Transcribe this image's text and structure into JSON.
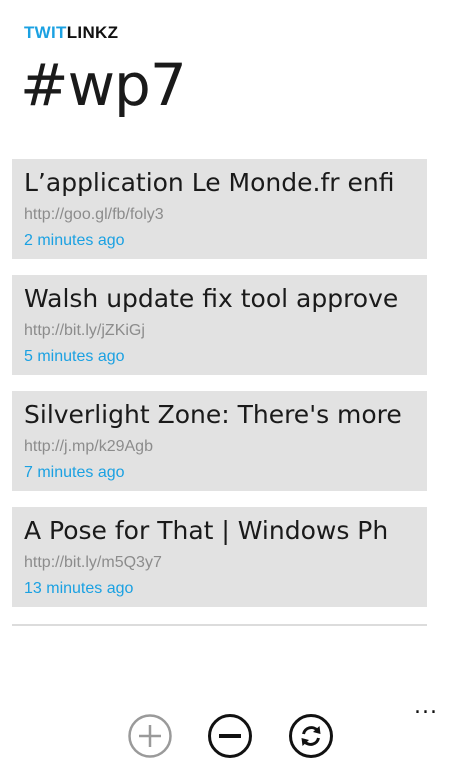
{
  "app": {
    "name_part1": "TWIT",
    "name_part2": "LINKZ",
    "accent_color": "#1ba1e2"
  },
  "page": {
    "title": "#wp7"
  },
  "items": [
    {
      "title": "L’application Le Monde.fr enfi",
      "url": "http://goo.gl/fb/foly3",
      "time": "2 minutes ago"
    },
    {
      "title": "Walsh update fix tool approve",
      "url": "http://bit.ly/jZKiGj",
      "time": "5 minutes ago"
    },
    {
      "title": "Silverlight Zone: There's more",
      "url": "http://j.mp/k29Agb",
      "time": "7 minutes ago"
    },
    {
      "title": "A Pose for That | Windows Ph",
      "url": "http://bit.ly/m5Q3y7",
      "time": "13 minutes ago"
    }
  ],
  "appbar": {
    "buttons": [
      {
        "icon": "plus-icon",
        "state": "disabled"
      },
      {
        "icon": "minus-icon",
        "state": "enabled"
      },
      {
        "icon": "refresh-icon",
        "state": "enabled"
      }
    ],
    "more_label": "..."
  }
}
